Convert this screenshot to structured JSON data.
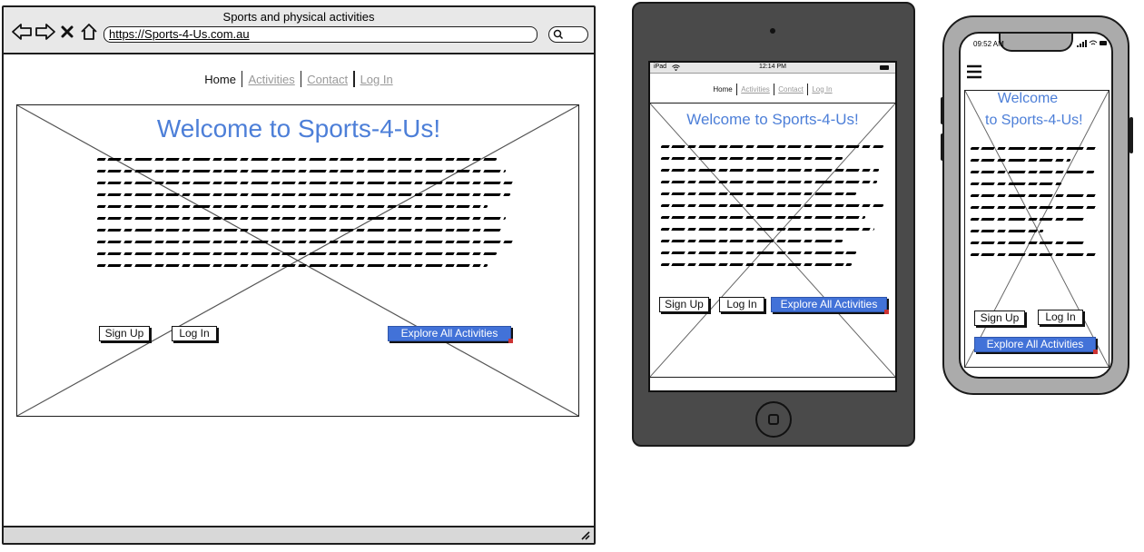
{
  "desktop": {
    "window_title": "Sports and physical activities",
    "url": "https://Sports-4-Us.com.au",
    "nav": [
      "Home",
      "Activities",
      "Contact",
      "Log In"
    ],
    "hero_title": "Welcome to Sports-4-Us!",
    "buttons": {
      "sign_up": "Sign Up",
      "log_in": "Log In",
      "explore": "Explore All Activities"
    }
  },
  "tablet": {
    "status_left": "iPad",
    "status_time": "12:14 PM",
    "nav": [
      "Home",
      "Activities",
      "Contact",
      "Log In"
    ],
    "hero_title": "Welcome to Sports-4-Us!",
    "buttons": {
      "sign_up": "Sign Up",
      "log_in": "Log In",
      "explore": "Explore All Activities"
    }
  },
  "phone": {
    "status_time": "09:52 AM",
    "hero_title_line1": "Welcome",
    "hero_title_line2": "to Sports-4-Us!",
    "buttons": {
      "sign_up": "Sign Up",
      "log_in": "Log In",
      "explore": "Explore All Activities"
    }
  },
  "colors": {
    "accent_blue": "#4d7fd8",
    "button_blue": "#4272d8",
    "device_dark": "#4a4a4a",
    "device_grey": "#ababab"
  }
}
